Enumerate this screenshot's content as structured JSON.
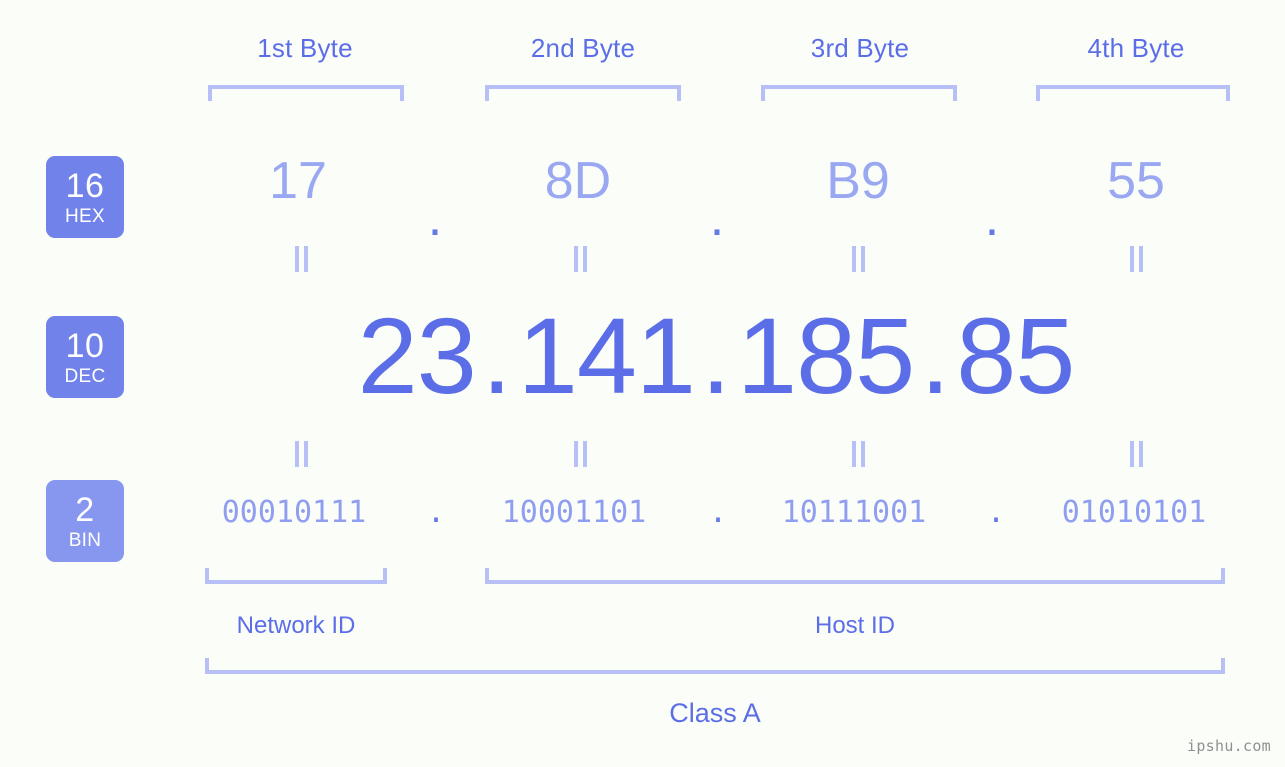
{
  "meta": {
    "background_color": "#fbfdf8",
    "accent_color": "#5b6ee8",
    "bracket_color": "#b6c0f7",
    "badge_color": "#7182ea",
    "badge_bin_color": "#8796ef",
    "watermark": "ipshu.com"
  },
  "byte_headers": [
    {
      "label": "1st Byte"
    },
    {
      "label": "2nd Byte"
    },
    {
      "label": "3rd Byte"
    },
    {
      "label": "4th Byte"
    }
  ],
  "bases": [
    {
      "number": "16",
      "name": "HEX"
    },
    {
      "number": "10",
      "name": "DEC"
    },
    {
      "number": "2",
      "name": "BIN"
    }
  ],
  "separator": ".",
  "equals_mark": "=",
  "rows": {
    "hex": {
      "octets": [
        "17",
        "8D",
        "B9",
        "55"
      ]
    },
    "dec": {
      "octets": [
        "23",
        "141",
        "185",
        "85"
      ]
    },
    "bin": {
      "octets": [
        "00010111",
        "10001101",
        "10111001",
        "01010101"
      ]
    }
  },
  "segments": {
    "network_id": "Network ID",
    "host_id": "Host ID",
    "class": "Class A"
  }
}
